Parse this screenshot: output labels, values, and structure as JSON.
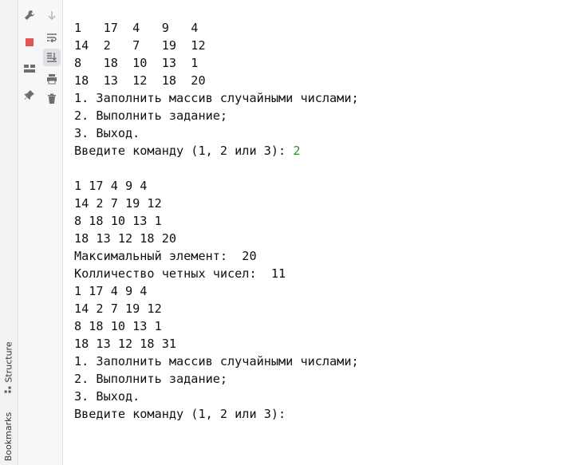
{
  "sidebar": {
    "structure_label": "Structure",
    "bookmarks_label": "Bookmarks"
  },
  "toolbar": {
    "icons": [
      "wrench-icon",
      "stop-icon",
      "layout-icon",
      "pin-icon",
      "down-arrow-icon",
      "soft-wrap-icon",
      "scroll-to-end-icon",
      "print-icon",
      "trash-icon"
    ]
  },
  "console": {
    "lines": [
      {
        "text": "1   17  4   9   4"
      },
      {
        "text": "14  2   7   19  12"
      },
      {
        "text": "8   18  10  13  1"
      },
      {
        "text": "18  13  12  18  20"
      },
      {
        "text": "1. Заполнить массив случайными числами;"
      },
      {
        "text": "2. Выполнить задание;"
      },
      {
        "text": "3. Выход."
      },
      {
        "text": "Введите команду (1, 2 или 3): ",
        "input": "2"
      },
      {
        "text": ""
      },
      {
        "text": "1 17 4 9 4"
      },
      {
        "text": "14 2 7 19 12"
      },
      {
        "text": "8 18 10 13 1"
      },
      {
        "text": "18 13 12 18 20"
      },
      {
        "text": "Максимальный элемент:  20"
      },
      {
        "text": "Колличество четных чисел:  11"
      },
      {
        "text": "1 17 4 9 4"
      },
      {
        "text": "14 2 7 19 12"
      },
      {
        "text": "8 18 10 13 1"
      },
      {
        "text": "18 13 12 18 31"
      },
      {
        "text": "1. Заполнить массив случайными числами;"
      },
      {
        "text": "2. Выполнить задание;"
      },
      {
        "text": "3. Выход."
      },
      {
        "text": "Введите команду (1, 2 или 3): "
      }
    ]
  },
  "colors": {
    "input_text": "#2a8f2a",
    "stop_icon": "#e05555"
  }
}
